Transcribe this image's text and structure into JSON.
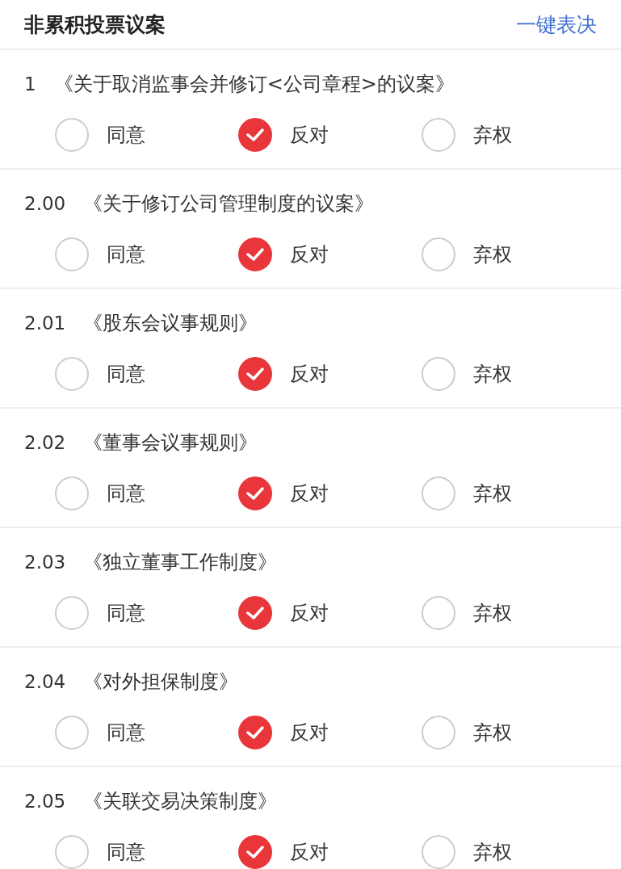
{
  "header": {
    "title": "非累积投票议案",
    "action": "一键表决"
  },
  "proposals": [
    {
      "number": "1",
      "title": "《关于取消监事会并修订<公司章程>的议案》",
      "options": [
        {
          "label": "同意",
          "selected": false
        },
        {
          "label": "反对",
          "selected": true
        },
        {
          "label": "弃权",
          "selected": false
        }
      ]
    },
    {
      "number": "2.00",
      "title": "《关于修订公司管理制度的议案》",
      "options": [
        {
          "label": "同意",
          "selected": false
        },
        {
          "label": "反对",
          "selected": true
        },
        {
          "label": "弃权",
          "selected": false
        }
      ]
    },
    {
      "number": "2.01",
      "title": "《股东会议事规则》",
      "options": [
        {
          "label": "同意",
          "selected": false
        },
        {
          "label": "反对",
          "selected": true
        },
        {
          "label": "弃权",
          "selected": false
        }
      ]
    },
    {
      "number": "2.02",
      "title": "《董事会议事规则》",
      "options": [
        {
          "label": "同意",
          "selected": false
        },
        {
          "label": "反对",
          "selected": true
        },
        {
          "label": "弃权",
          "selected": false
        }
      ]
    },
    {
      "number": "2.03",
      "title": "《独立董事工作制度》",
      "options": [
        {
          "label": "同意",
          "selected": false
        },
        {
          "label": "反对",
          "selected": true
        },
        {
          "label": "弃权",
          "selected": false
        }
      ]
    },
    {
      "number": "2.04",
      "title": "《对外担保制度》",
      "options": [
        {
          "label": "同意",
          "selected": false
        },
        {
          "label": "反对",
          "selected": true
        },
        {
          "label": "弃权",
          "selected": false
        }
      ]
    },
    {
      "number": "2.05",
      "title": "《关联交易决策制度》",
      "options": [
        {
          "label": "同意",
          "selected": false
        },
        {
          "label": "反对",
          "selected": true
        },
        {
          "label": "弃权",
          "selected": false
        }
      ]
    }
  ]
}
